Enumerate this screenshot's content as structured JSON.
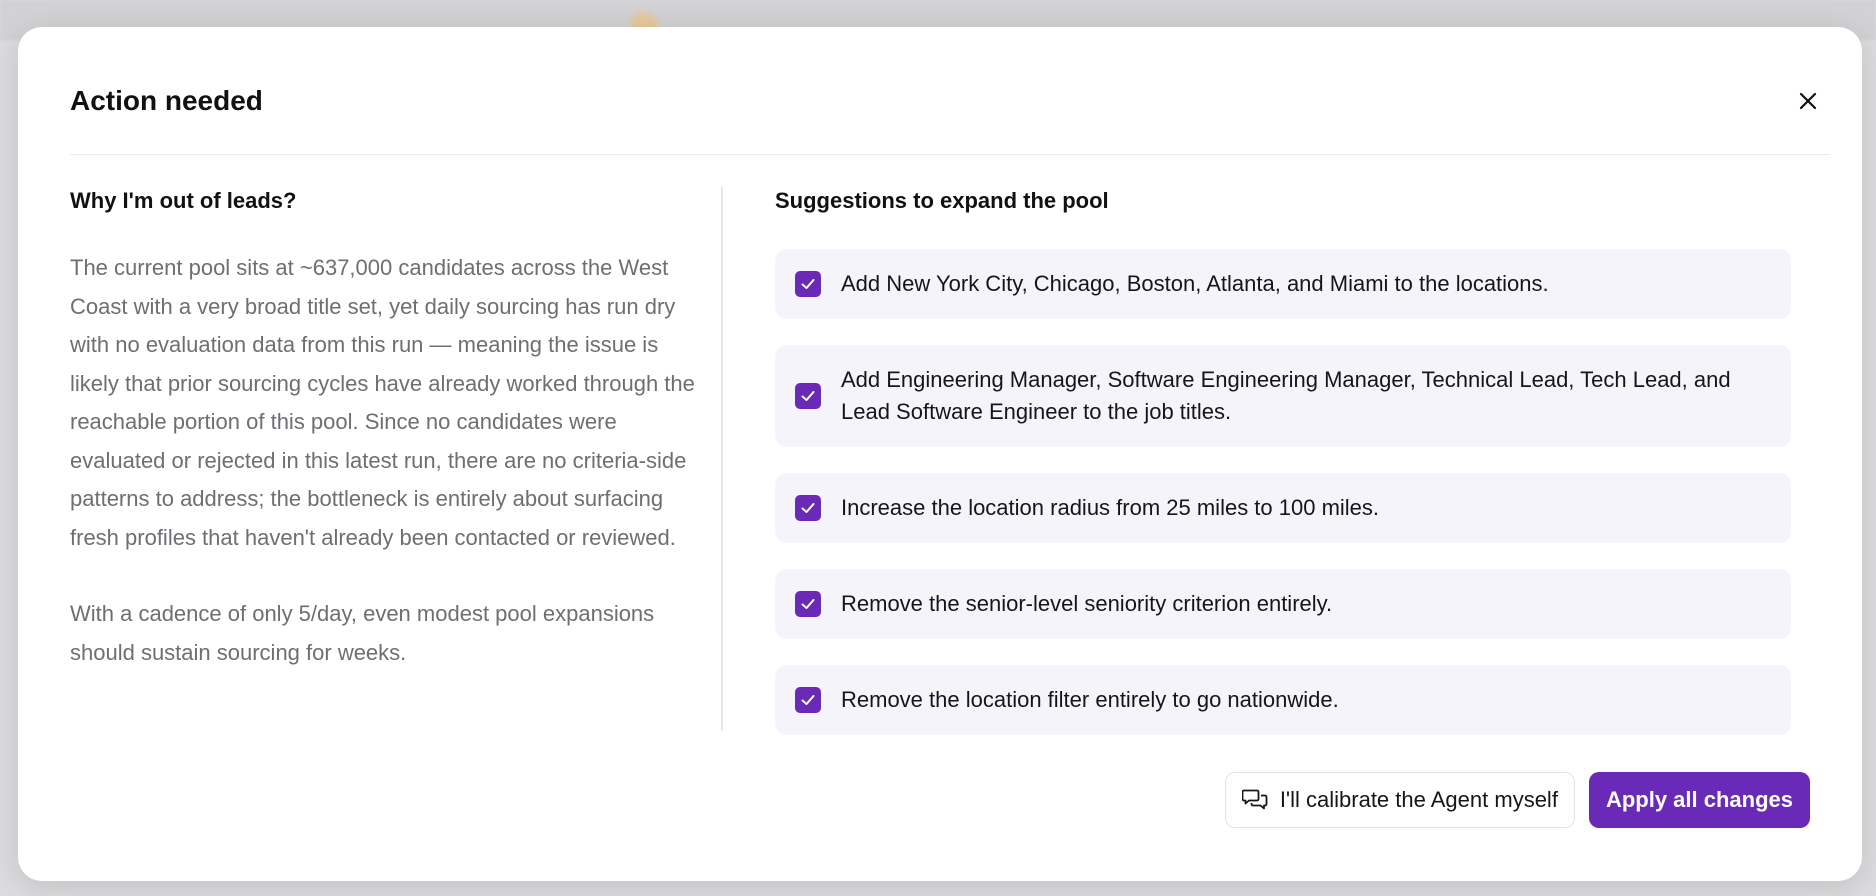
{
  "modal": {
    "title": "Action needed",
    "close_icon": "close-icon"
  },
  "left": {
    "heading": "Why I'm out of leads?",
    "paragraphs": [
      "The current pool sits at ~637,000 candidates across the West Coast with a very broad title set, yet daily sourcing has run dry with no evaluation data from this run — meaning the issue is likely that prior sourcing cycles have already worked through the reachable portion of this pool. Since no candidates were evaluated or rejected in this latest run, there are no criteria-side patterns to address; the bottleneck is entirely about surfacing fresh profiles that haven't already been contacted or reviewed.",
      "With a cadence of only 5/day, even modest pool expansions should sustain sourcing for weeks."
    ]
  },
  "right": {
    "heading": "Suggestions to expand the pool",
    "suggestions": [
      {
        "text": "Add New York City, Chicago, Boston, Atlanta, and Miami to the locations.",
        "checked": true
      },
      {
        "text": "Add Engineering Manager, Software Engineering Manager, Technical Lead, Tech Lead, and Lead Software Engineer to the job titles.",
        "checked": true
      },
      {
        "text": "Increase the location radius from 25 miles to 100 miles.",
        "checked": true
      },
      {
        "text": "Remove the senior-level seniority criterion entirely.",
        "checked": true
      },
      {
        "text": "Remove the location filter entirely to go nationwide.",
        "checked": true
      }
    ]
  },
  "footer": {
    "secondary_label": "I'll calibrate the Agent myself",
    "secondary_icon": "chat-bubbles-icon",
    "primary_label": "Apply all changes"
  },
  "colors": {
    "accent": "#6a2ab8",
    "suggestion_bg": "#f6f4fb",
    "body_text": "#6e6e73"
  }
}
